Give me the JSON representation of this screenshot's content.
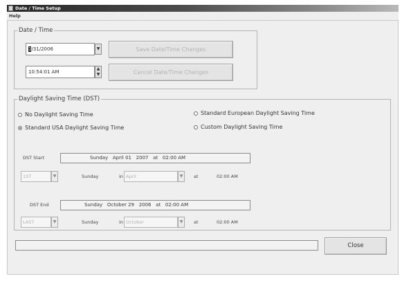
{
  "window": {
    "title": "Date / Time Setup",
    "menu": "Help"
  },
  "date_time_group": {
    "label": "Date / Time",
    "date_field": {
      "selected": "1",
      "rest": "/31/2006"
    },
    "time_field": "10:54:01 AM",
    "save_button": "Save Date/Time Changes",
    "cancel_button": "Cancel Date/Time Changes"
  },
  "dst_group": {
    "label": "Daylight Saving Time (DST)",
    "options": {
      "no_dst": "No Daylight Saving Time",
      "usa": "Standard USA Daylight Saving Time",
      "european": "Standard European Daylight Saving Time",
      "custom": "Custom Daylight Saving Time"
    },
    "selected_option": "usa",
    "start": {
      "label": "DST Start",
      "display": "Sunday   April 01   2007   at   02:00 AM",
      "week": "1ST",
      "day": "Sunday",
      "in_label": "in",
      "month": "April",
      "at_label": "at",
      "time": "02:00 AM"
    },
    "end": {
      "label": "DST End",
      "display": "Sunday   October 29   2006   at   02:00 AM",
      "week": "LAST",
      "day": "Sunday",
      "in_label": "in",
      "month": "October",
      "at_label": "at",
      "time": "02:00 AM"
    }
  },
  "close_button": "Close"
}
